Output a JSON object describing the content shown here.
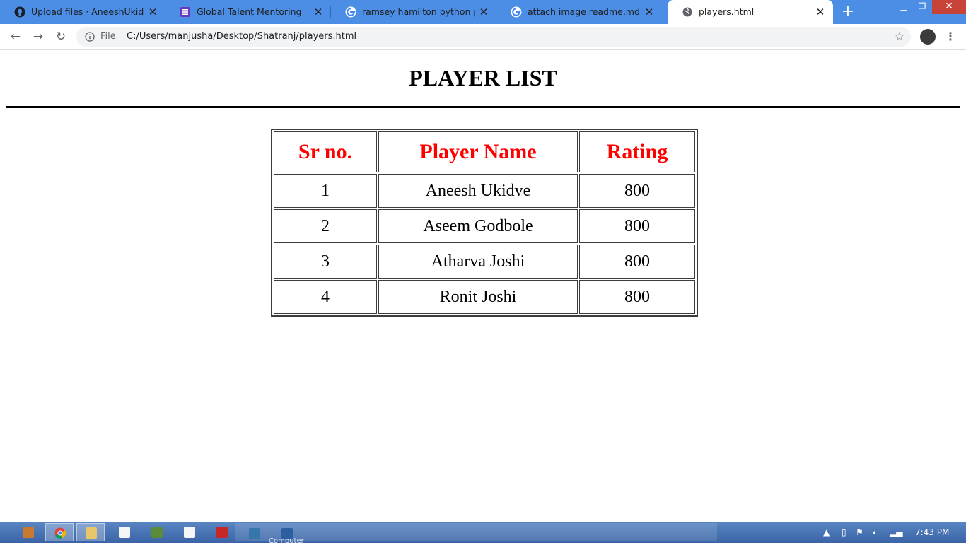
{
  "browser": {
    "tabs": [
      {
        "title": "Upload files · AneeshUkidve/Glo",
        "icon": "github-icon"
      },
      {
        "title": "Global Talent Mentoring",
        "icon": "form-icon"
      },
      {
        "title": "ramsey hamilton python pdf - G",
        "icon": "google-icon"
      },
      {
        "title": "attach image readme.md - Goo",
        "icon": "google-icon"
      },
      {
        "title": "players.html",
        "icon": "globe-icon"
      }
    ],
    "address": {
      "scheme_label": "File",
      "url": "C:/Users/manjusha/Desktop/Shatranj/players.html"
    }
  },
  "page": {
    "heading": "PLAYER LIST",
    "table": {
      "headers": [
        "Sr no.",
        "Player Name",
        "Rating"
      ],
      "rows": [
        [
          "1",
          "Aneesh Ukidve",
          "800"
        ],
        [
          "2",
          "Aseem Godbole",
          "800"
        ],
        [
          "3",
          "Atharva Joshi",
          "800"
        ],
        [
          "4",
          "Ronit Joshi",
          "800"
        ]
      ]
    }
  },
  "taskbar": {
    "group_label": "Computer",
    "clock": "7:43 PM"
  },
  "colors": {
    "header_text": "#ff0000",
    "tab_strip": "#4c8ee6"
  }
}
